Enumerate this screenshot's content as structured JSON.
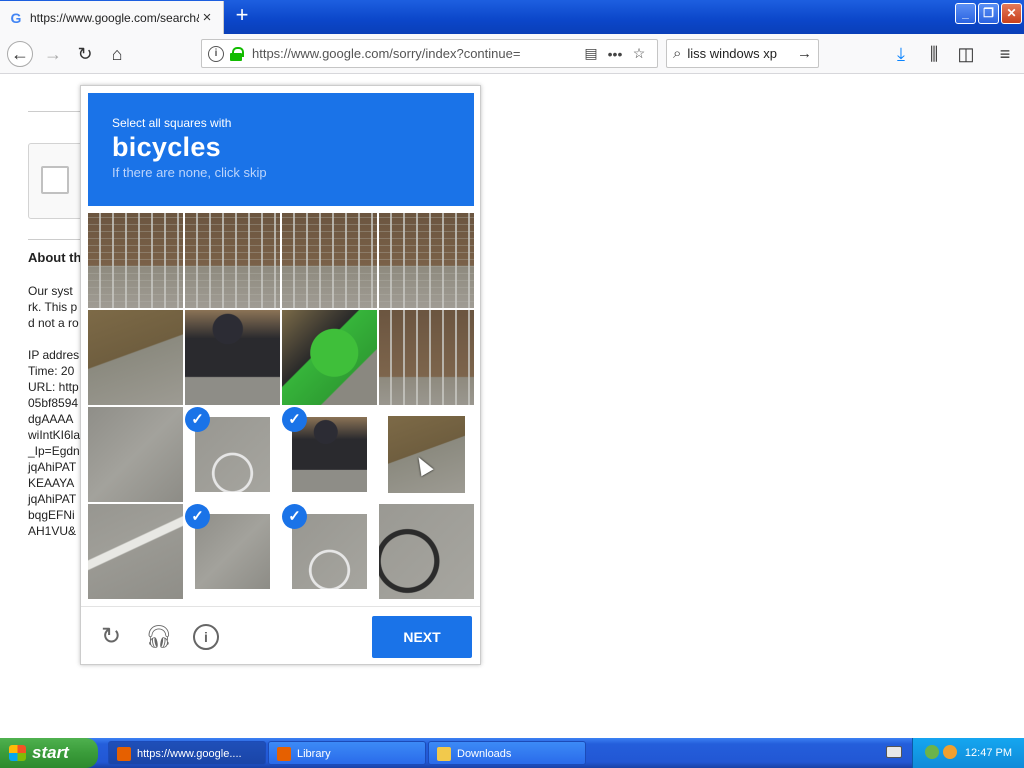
{
  "browser": {
    "tab_title": "https://www.google.com/search&",
    "tab_favicon": "G",
    "new_tab": "+",
    "url": "https://www.google.com/sorry/index?continue=",
    "search_query": "liss windows xp"
  },
  "window_controls": {
    "minimize": "_",
    "maximize": "❐",
    "close": "✕"
  },
  "page": {
    "about_heading": "About th",
    "lines": [
      "Our syst",
      "rk. This p",
      "d not a ro",
      "",
      "IP addres",
      "Time: 20",
      "URL: http",
      "05bf8594",
      "dgAAAA",
      "wiIntKI6la",
      "_Ip=Egdn",
      "jqAhiPAT",
      "KEAAYA",
      "jqAhiPAT",
      "bqgEFNi",
      "AH1VU&"
    ]
  },
  "captcha": {
    "instruction_prefix": "Select all squares with",
    "target_word": "bicycles",
    "instruction_sub": "If there are none, click skip",
    "next_label": "NEXT",
    "tiles": [
      {
        "row": 0,
        "col": 0,
        "texture": "fence",
        "selected": false
      },
      {
        "row": 0,
        "col": 1,
        "texture": "fence",
        "selected": false
      },
      {
        "row": 0,
        "col": 2,
        "texture": "fence",
        "selected": false
      },
      {
        "row": 0,
        "col": 3,
        "texture": "fence",
        "selected": false
      },
      {
        "row": 1,
        "col": 0,
        "texture": "grass",
        "selected": false
      },
      {
        "row": 1,
        "col": 1,
        "texture": "rider",
        "selected": false
      },
      {
        "row": 1,
        "col": 2,
        "texture": "bag",
        "selected": false
      },
      {
        "row": 1,
        "col": 3,
        "texture": "fence-b",
        "selected": false
      },
      {
        "row": 2,
        "col": 0,
        "texture": "road",
        "selected": false
      },
      {
        "row": 2,
        "col": 1,
        "texture": "bike",
        "selected": true
      },
      {
        "row": 2,
        "col": 2,
        "texture": "rider",
        "selected": true
      },
      {
        "row": 2,
        "col": 3,
        "texture": "grass",
        "selected": false,
        "replaced": true
      },
      {
        "row": 3,
        "col": 0,
        "texture": "road-line",
        "selected": false
      },
      {
        "row": 3,
        "col": 1,
        "texture": "road",
        "selected": true
      },
      {
        "row": 3,
        "col": 2,
        "texture": "bike",
        "selected": true
      },
      {
        "row": 3,
        "col": 3,
        "texture": "bike2",
        "selected": false
      }
    ],
    "accent_color": "#1a73e8"
  },
  "taskbar": {
    "start_label": "start",
    "tasks": [
      {
        "label": "https://www.google....",
        "active": true
      },
      {
        "label": "Library",
        "active": false
      },
      {
        "label": "Downloads",
        "active": false
      }
    ],
    "clock": "12:47 PM"
  }
}
